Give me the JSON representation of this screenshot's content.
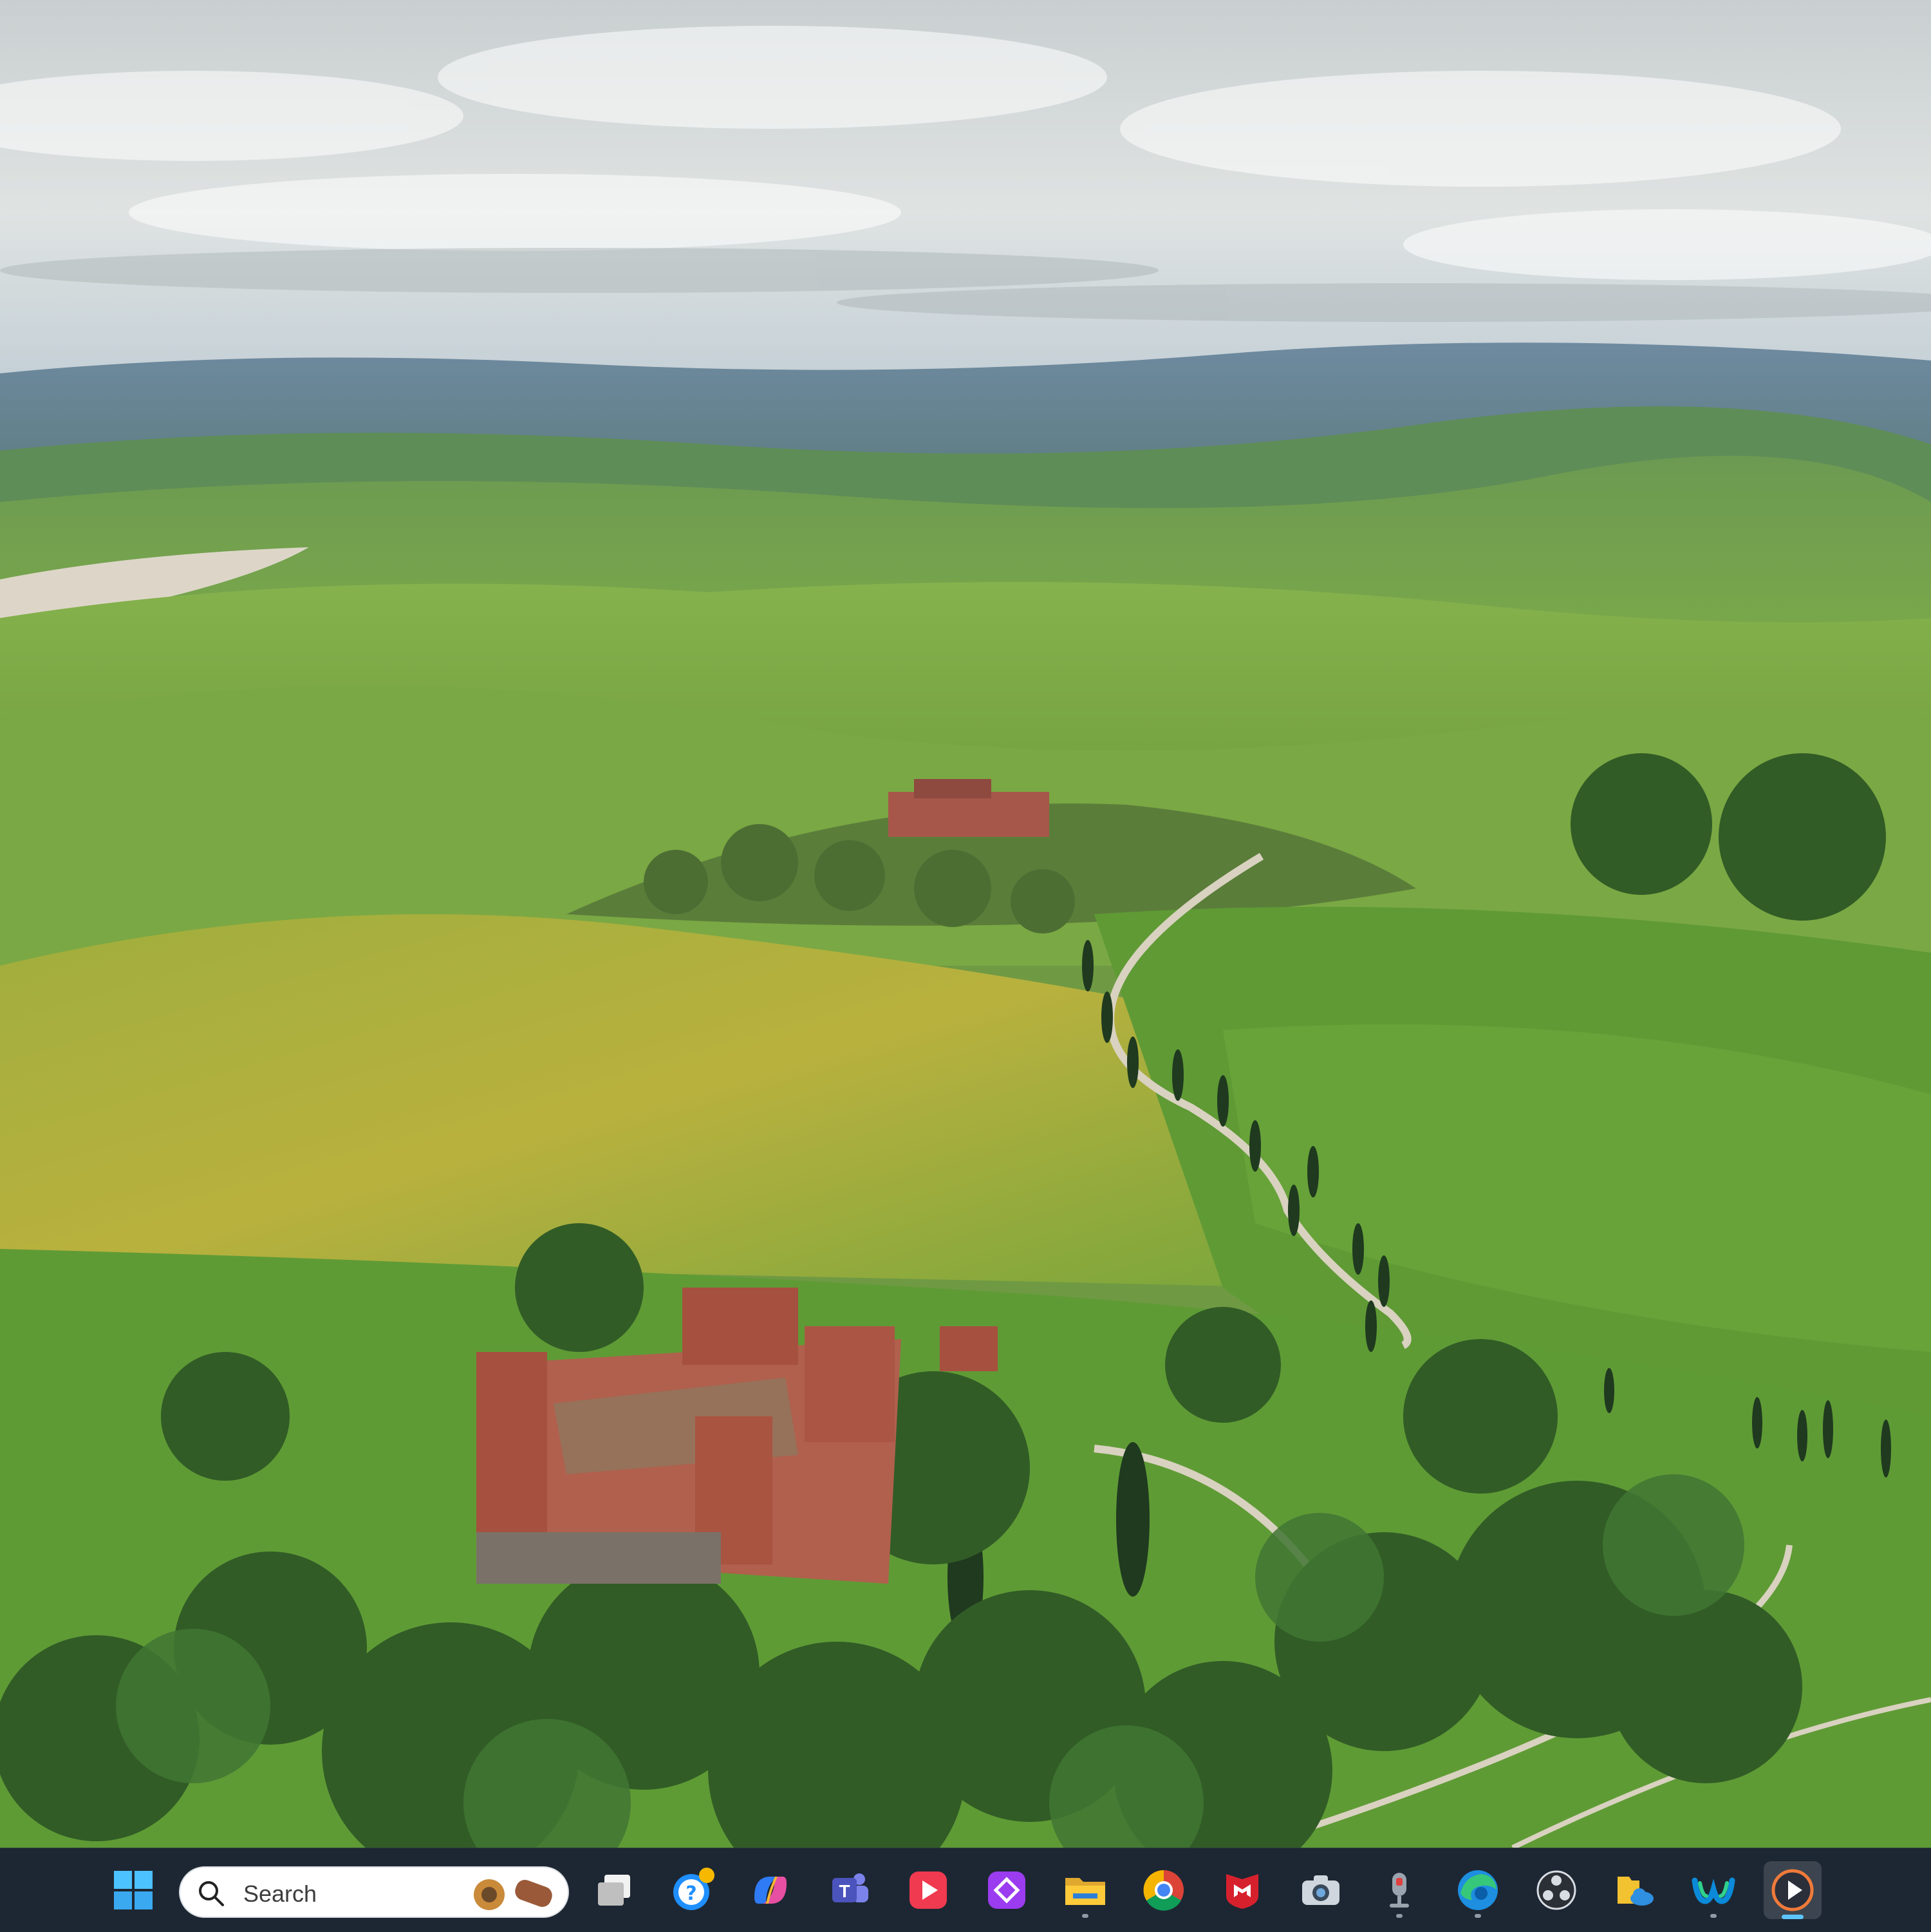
{
  "wallpaper": {
    "description_name": "tuscany-landscape"
  },
  "taskbar": {
    "search": {
      "placeholder": "Search"
    },
    "pinned": [
      {
        "name": "start",
        "icon": "windows-logo-icon"
      },
      {
        "name": "task-view",
        "icon": "task-view-icon"
      },
      {
        "name": "get-help",
        "icon": "help-icon"
      },
      {
        "name": "copilot",
        "icon": "copilot-icon"
      },
      {
        "name": "teams",
        "icon": "teams-icon"
      },
      {
        "name": "video-player",
        "icon": "play-red-icon"
      },
      {
        "name": "purple-app",
        "icon": "diamond-app-icon"
      },
      {
        "name": "file-explorer",
        "icon": "folder-icon"
      },
      {
        "name": "chrome",
        "icon": "chrome-icon"
      },
      {
        "name": "mcafee",
        "icon": "mcafee-icon"
      },
      {
        "name": "camera",
        "icon": "camera-icon"
      },
      {
        "name": "voice-recorder",
        "icon": "microphone-icon"
      },
      {
        "name": "edge",
        "icon": "edge-icon"
      },
      {
        "name": "obs-studio",
        "icon": "obs-icon"
      },
      {
        "name": "file-sync",
        "icon": "folder-cloud-icon"
      },
      {
        "name": "webex",
        "icon": "webex-icon"
      },
      {
        "name": "media-player",
        "icon": "media-player-icon"
      }
    ],
    "colors": {
      "bar": "#1d2733",
      "active_indicator": "#5cc5ff"
    }
  }
}
